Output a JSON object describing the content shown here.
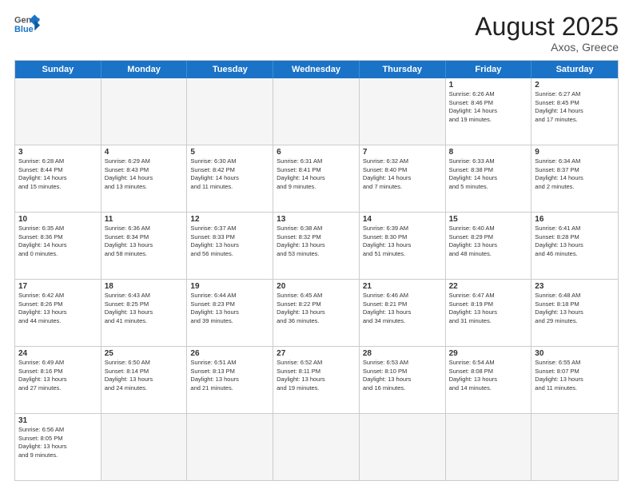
{
  "header": {
    "logo_general": "General",
    "logo_blue": "Blue",
    "month_title": "August 2025",
    "subtitle": "Axos, Greece"
  },
  "days_of_week": [
    "Sunday",
    "Monday",
    "Tuesday",
    "Wednesday",
    "Thursday",
    "Friday",
    "Saturday"
  ],
  "weeks": [
    [
      {
        "day": "",
        "empty": true,
        "text": ""
      },
      {
        "day": "",
        "empty": true,
        "text": ""
      },
      {
        "day": "",
        "empty": true,
        "text": ""
      },
      {
        "day": "",
        "empty": true,
        "text": ""
      },
      {
        "day": "",
        "empty": true,
        "text": ""
      },
      {
        "day": "1",
        "text": "Sunrise: 6:26 AM\nSunset: 8:46 PM\nDaylight: 14 hours\nand 19 minutes."
      },
      {
        "day": "2",
        "text": "Sunrise: 6:27 AM\nSunset: 8:45 PM\nDaylight: 14 hours\nand 17 minutes."
      }
    ],
    [
      {
        "day": "3",
        "text": "Sunrise: 6:28 AM\nSunset: 8:44 PM\nDaylight: 14 hours\nand 15 minutes."
      },
      {
        "day": "4",
        "text": "Sunrise: 6:29 AM\nSunset: 8:43 PM\nDaylight: 14 hours\nand 13 minutes."
      },
      {
        "day": "5",
        "text": "Sunrise: 6:30 AM\nSunset: 8:42 PM\nDaylight: 14 hours\nand 11 minutes."
      },
      {
        "day": "6",
        "text": "Sunrise: 6:31 AM\nSunset: 8:41 PM\nDaylight: 14 hours\nand 9 minutes."
      },
      {
        "day": "7",
        "text": "Sunrise: 6:32 AM\nSunset: 8:40 PM\nDaylight: 14 hours\nand 7 minutes."
      },
      {
        "day": "8",
        "text": "Sunrise: 6:33 AM\nSunset: 8:38 PM\nDaylight: 14 hours\nand 5 minutes."
      },
      {
        "day": "9",
        "text": "Sunrise: 6:34 AM\nSunset: 8:37 PM\nDaylight: 14 hours\nand 2 minutes."
      }
    ],
    [
      {
        "day": "10",
        "text": "Sunrise: 6:35 AM\nSunset: 8:36 PM\nDaylight: 14 hours\nand 0 minutes."
      },
      {
        "day": "11",
        "text": "Sunrise: 6:36 AM\nSunset: 8:34 PM\nDaylight: 13 hours\nand 58 minutes."
      },
      {
        "day": "12",
        "text": "Sunrise: 6:37 AM\nSunset: 8:33 PM\nDaylight: 13 hours\nand 56 minutes."
      },
      {
        "day": "13",
        "text": "Sunrise: 6:38 AM\nSunset: 8:32 PM\nDaylight: 13 hours\nand 53 minutes."
      },
      {
        "day": "14",
        "text": "Sunrise: 6:39 AM\nSunset: 8:30 PM\nDaylight: 13 hours\nand 51 minutes."
      },
      {
        "day": "15",
        "text": "Sunrise: 6:40 AM\nSunset: 8:29 PM\nDaylight: 13 hours\nand 48 minutes."
      },
      {
        "day": "16",
        "text": "Sunrise: 6:41 AM\nSunset: 8:28 PM\nDaylight: 13 hours\nand 46 minutes."
      }
    ],
    [
      {
        "day": "17",
        "text": "Sunrise: 6:42 AM\nSunset: 8:26 PM\nDaylight: 13 hours\nand 44 minutes."
      },
      {
        "day": "18",
        "text": "Sunrise: 6:43 AM\nSunset: 8:25 PM\nDaylight: 13 hours\nand 41 minutes."
      },
      {
        "day": "19",
        "text": "Sunrise: 6:44 AM\nSunset: 8:23 PM\nDaylight: 13 hours\nand 39 minutes."
      },
      {
        "day": "20",
        "text": "Sunrise: 6:45 AM\nSunset: 8:22 PM\nDaylight: 13 hours\nand 36 minutes."
      },
      {
        "day": "21",
        "text": "Sunrise: 6:46 AM\nSunset: 8:21 PM\nDaylight: 13 hours\nand 34 minutes."
      },
      {
        "day": "22",
        "text": "Sunrise: 6:47 AM\nSunset: 8:19 PM\nDaylight: 13 hours\nand 31 minutes."
      },
      {
        "day": "23",
        "text": "Sunrise: 6:48 AM\nSunset: 8:18 PM\nDaylight: 13 hours\nand 29 minutes."
      }
    ],
    [
      {
        "day": "24",
        "text": "Sunrise: 6:49 AM\nSunset: 8:16 PM\nDaylight: 13 hours\nand 27 minutes."
      },
      {
        "day": "25",
        "text": "Sunrise: 6:50 AM\nSunset: 8:14 PM\nDaylight: 13 hours\nand 24 minutes."
      },
      {
        "day": "26",
        "text": "Sunrise: 6:51 AM\nSunset: 8:13 PM\nDaylight: 13 hours\nand 21 minutes."
      },
      {
        "day": "27",
        "text": "Sunrise: 6:52 AM\nSunset: 8:11 PM\nDaylight: 13 hours\nand 19 minutes."
      },
      {
        "day": "28",
        "text": "Sunrise: 6:53 AM\nSunset: 8:10 PM\nDaylight: 13 hours\nand 16 minutes."
      },
      {
        "day": "29",
        "text": "Sunrise: 6:54 AM\nSunset: 8:08 PM\nDaylight: 13 hours\nand 14 minutes."
      },
      {
        "day": "30",
        "text": "Sunrise: 6:55 AM\nSunset: 8:07 PM\nDaylight: 13 hours\nand 11 minutes."
      }
    ],
    [
      {
        "day": "31",
        "text": "Sunrise: 6:56 AM\nSunset: 8:05 PM\nDaylight: 13 hours\nand 9 minutes."
      },
      {
        "day": "",
        "empty": true,
        "text": ""
      },
      {
        "day": "",
        "empty": true,
        "text": ""
      },
      {
        "day": "",
        "empty": true,
        "text": ""
      },
      {
        "day": "",
        "empty": true,
        "text": ""
      },
      {
        "day": "",
        "empty": true,
        "text": ""
      },
      {
        "day": "",
        "empty": true,
        "text": ""
      }
    ]
  ]
}
